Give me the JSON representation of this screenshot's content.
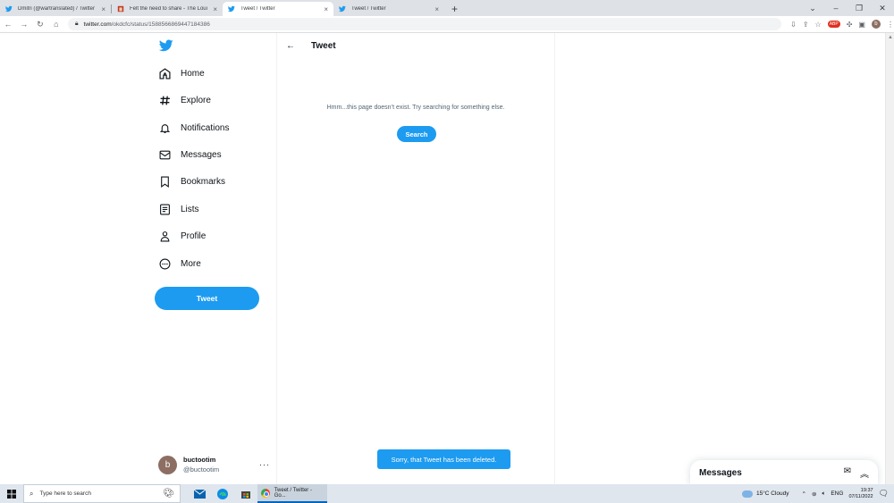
{
  "browser": {
    "tabs": [
      {
        "title": "Dmitri (@wartranslated) / Twitter",
        "active": false
      },
      {
        "title": "Felt the need to share - The Loui",
        "active": false
      },
      {
        "title": "Tweet / Twitter",
        "active": true
      },
      {
        "title": "Tweet / Twitter",
        "active": false
      }
    ],
    "close_glyph": "×",
    "newtab_glyph": "+",
    "window_controls": {
      "minimize": "–",
      "maximize": "❐",
      "close": "✕"
    },
    "url_host": "twitter.com",
    "url_path": "/okdcfc/status/1588566869447184386",
    "profile_initial": "b",
    "adblock_label": "ABP"
  },
  "sidebar": {
    "items": [
      {
        "label": "Home",
        "icon": "home-icon"
      },
      {
        "label": "Explore",
        "icon": "hashtag-icon"
      },
      {
        "label": "Notifications",
        "icon": "bell-icon"
      },
      {
        "label": "Messages",
        "icon": "envelope-icon"
      },
      {
        "label": "Bookmarks",
        "icon": "bookmark-icon"
      },
      {
        "label": "Lists",
        "icon": "list-icon"
      },
      {
        "label": "Profile",
        "icon": "person-icon"
      },
      {
        "label": "More",
        "icon": "more-circle-icon"
      }
    ],
    "tweet_button": "Tweet",
    "account": {
      "initial": "b",
      "name": "buctootim",
      "handle": "@buctootim",
      "more": "···"
    }
  },
  "main": {
    "title": "Tweet",
    "back_glyph": "←",
    "empty_message": "Hmm...this page doesn’t exist. Try searching for something else.",
    "search_button": "Search",
    "toast": "Sorry, that Tweet has been deleted."
  },
  "messages_drawer": {
    "title": "Messages"
  },
  "taskbar": {
    "search_placeholder": "Type here to search",
    "chrome_title": "Tweet / Twitter - Go...",
    "weather": "15°C Cloudy",
    "language": "ENG",
    "time": "19:37",
    "date": "07/11/2022"
  },
  "colors": {
    "accent": "#1d9bf0",
    "text": "#0f1419",
    "muted": "#536471"
  }
}
